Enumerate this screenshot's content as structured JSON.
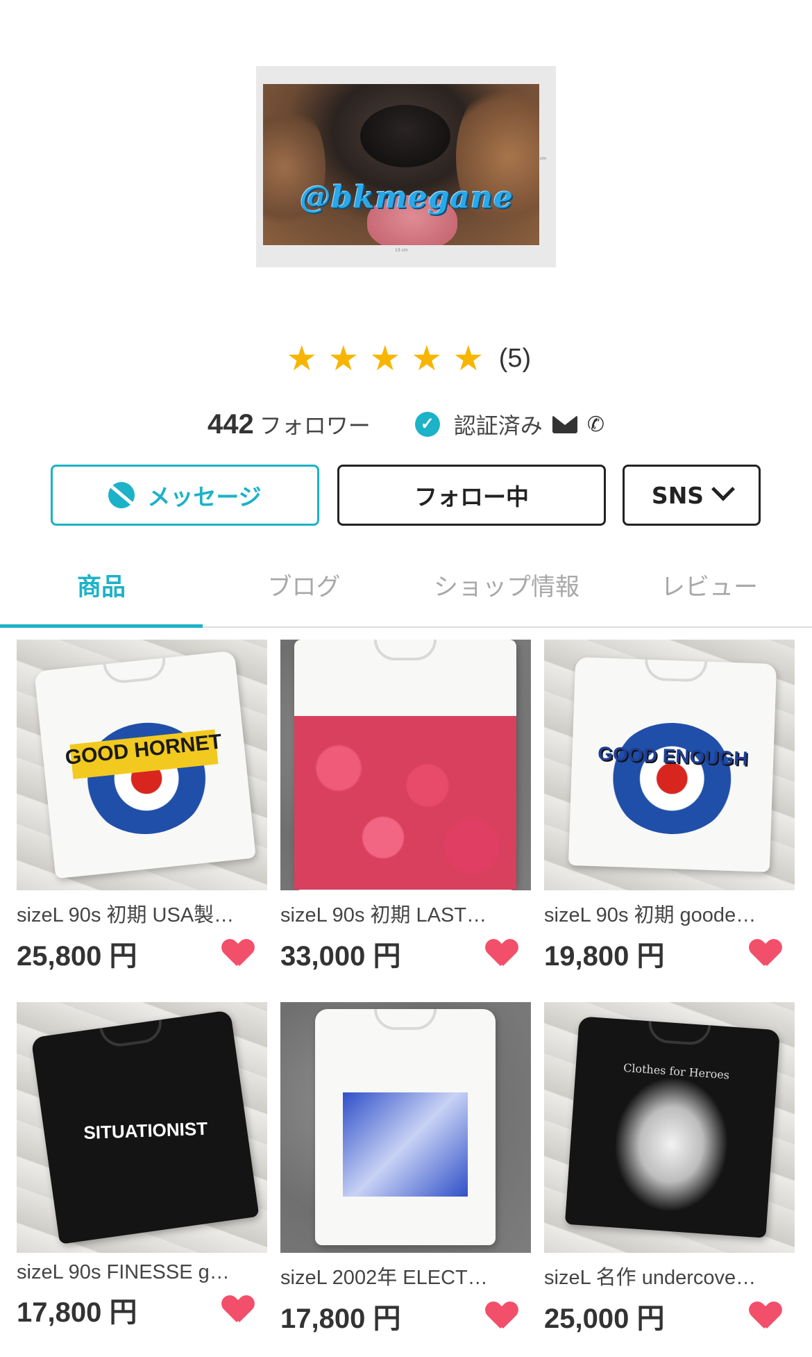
{
  "shop": {
    "handle_text": "@bkmegane",
    "scale_x": "13 cm",
    "scale_y": "7 cm"
  },
  "rating": {
    "stars": 5,
    "count": "(5)"
  },
  "profile": {
    "followers_count": "442",
    "followers_label": "フォロワー",
    "verified_label": "認証済み"
  },
  "actions": {
    "message": "メッセージ",
    "follow": "フォロー中",
    "sns": "SNS"
  },
  "tabs": [
    {
      "label": "商品",
      "active": true
    },
    {
      "label": "ブログ",
      "active": false
    },
    {
      "label": "ショップ情報",
      "active": false
    },
    {
      "label": "レビュー",
      "active": false
    }
  ],
  "products": [
    {
      "title": "sizeL 90s 初期 USA製…",
      "price": "25,800 円",
      "print_text": "GOOD HORNET"
    },
    {
      "title": "sizeL 90s 初期 LAST…",
      "price": "33,000 円",
      "print_text": ""
    },
    {
      "title": "sizeL 90s 初期 goode…",
      "price": "19,800 円",
      "print_text": "GOOD ENOUGH"
    },
    {
      "title": "sizeL 90s FINESSE g…",
      "price": "17,800 円",
      "print_text": "SITUATIONIST"
    },
    {
      "title": "sizeL 2002年 ELECT…",
      "price": "17,800 円",
      "print_text": ""
    },
    {
      "title": "sizeL 名作 undercove…",
      "price": "25,000 円",
      "print_text": "Clothes for Heroes"
    }
  ],
  "colors": {
    "accent": "#1cb2c8",
    "star": "#f7b500",
    "heart": "#f24f6b"
  }
}
